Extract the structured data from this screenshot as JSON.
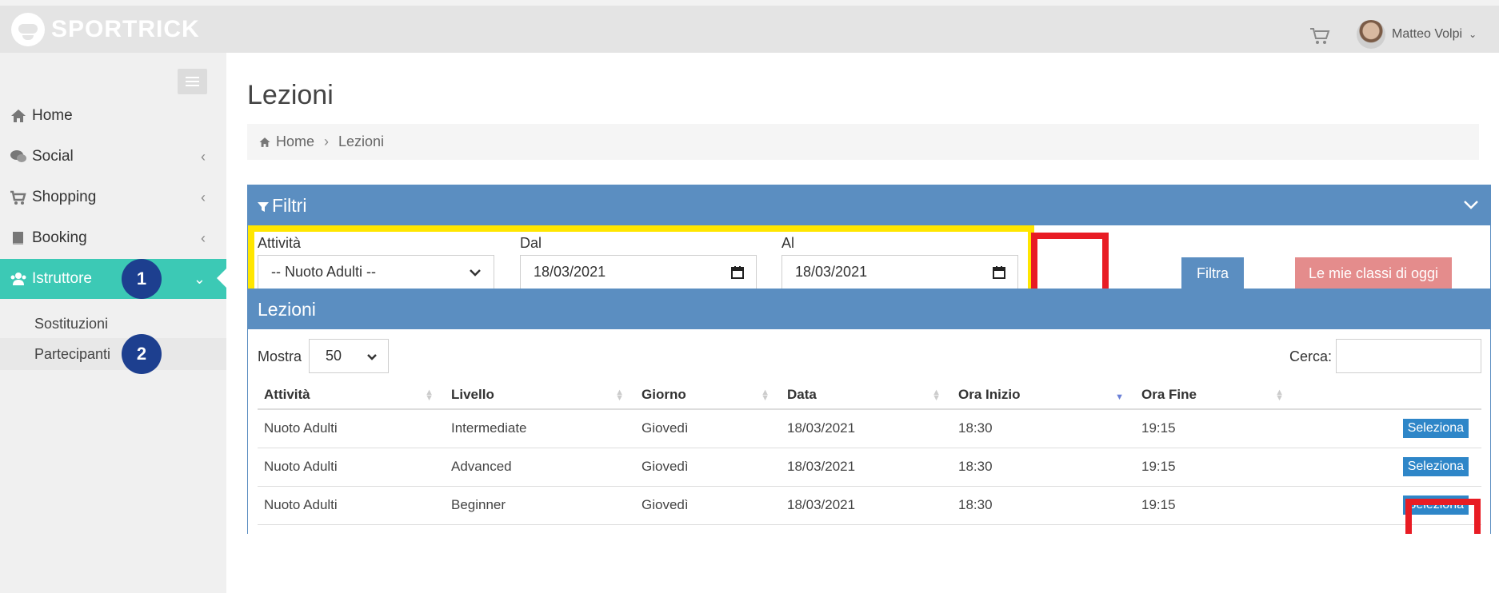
{
  "brand": {
    "name": "SPORTRICK"
  },
  "header": {
    "user_name": "Matteo Volpi"
  },
  "sidebar": {
    "items": [
      {
        "label": "Home",
        "icon": "home-icon"
      },
      {
        "label": "Social",
        "icon": "comments-icon"
      },
      {
        "label": "Shopping",
        "icon": "cart-icon"
      },
      {
        "label": "Booking",
        "icon": "book-icon"
      },
      {
        "label": "Istruttore",
        "icon": "users-icon",
        "active": true
      }
    ],
    "subitems": [
      {
        "label": "Sostituzioni"
      },
      {
        "label": "Partecipanti"
      }
    ],
    "badges": [
      "1",
      "2"
    ]
  },
  "page": {
    "title": "Lezioni"
  },
  "breadcrumb": {
    "home": "Home",
    "current": "Lezioni"
  },
  "filters": {
    "panel_title": "Filtri",
    "activity_label": "Attività",
    "activity_value": "-- Nuoto Adulti --",
    "from_label": "Dal",
    "from_value": "18/03/2021",
    "to_label": "Al",
    "to_value": "18/03/2021",
    "filter_button": "Filtra",
    "today_button": "Le mie classi di oggi"
  },
  "lessons": {
    "panel_title": "Lezioni",
    "show_label": "Mostra",
    "show_value": "50",
    "search_label": "Cerca:",
    "columns": [
      "Attività",
      "Livello",
      "Giorno",
      "Data",
      "Ora Inizio",
      "Ora Fine"
    ],
    "select_label": "Seleziona",
    "rows": [
      {
        "attivita": "Nuoto Adulti",
        "livello": "Intermediate",
        "giorno": "Giovedì",
        "data": "18/03/2021",
        "inizio": "18:30",
        "fine": "19:15"
      },
      {
        "attivita": "Nuoto Adulti",
        "livello": "Advanced",
        "giorno": "Giovedì",
        "data": "18/03/2021",
        "inizio": "18:30",
        "fine": "19:15"
      },
      {
        "attivita": "Nuoto Adulti",
        "livello": "Beginner",
        "giorno": "Giovedì",
        "data": "18/03/2021",
        "inizio": "18:30",
        "fine": "19:15"
      }
    ]
  },
  "colors": {
    "header_bg": "#e4e4e4",
    "sidebar_bg": "#f0f0f0",
    "active_nav": "#3cc9b5",
    "panel": "#5b8ec1",
    "select_button": "#2e86c8",
    "today_button": "#e48c8c",
    "highlight_yellow": "#ffe600",
    "highlight_red": "#e81c24",
    "badge": "#1d3f8f"
  }
}
